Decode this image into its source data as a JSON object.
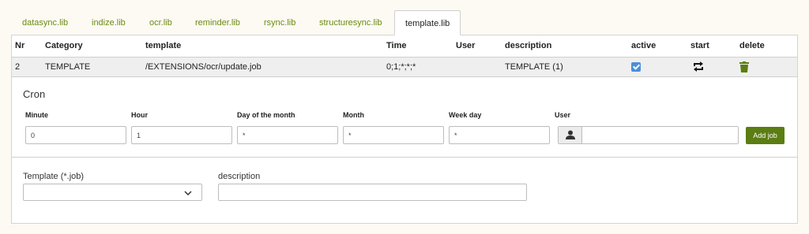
{
  "tabs": [
    {
      "label": "datasync.lib"
    },
    {
      "label": "indize.lib"
    },
    {
      "label": "ocr.lib"
    },
    {
      "label": "reminder.lib"
    },
    {
      "label": "rsync.lib"
    },
    {
      "label": "structuresync.lib"
    },
    {
      "label": "template.lib",
      "active": true
    }
  ],
  "table": {
    "headers": {
      "nr": "Nr",
      "category": "Category",
      "template": "template",
      "time": "Time",
      "user": "User",
      "description": "description",
      "active": "active",
      "start": "start",
      "delete": "delete"
    },
    "rows": [
      {
        "nr": "2",
        "category": "TEMPLATE",
        "template": "/EXTENSIONS/ocr/update.job",
        "time": "0;1;*;*;*",
        "user": "",
        "description": "TEMPLATE (1)",
        "active": true
      }
    ]
  },
  "cron": {
    "title": "Cron",
    "labels": {
      "minute": "Minute",
      "hour": "Hour",
      "day_of_month": "Day of the month",
      "month": "Month",
      "week_day": "Week day",
      "user": "User"
    },
    "values": {
      "minute": "0",
      "hour": "1",
      "day_of_month": "*",
      "month": "*",
      "week_day": "*",
      "user": ""
    },
    "add_button": "Add job"
  },
  "template_form": {
    "template_label": "Template (*.job)",
    "template_value": "",
    "description_label": "description",
    "description_value": ""
  },
  "colors": {
    "accent": "#5b7d12",
    "tab_link": "#6b8a12",
    "checkbox": "#4a90d9",
    "page_bg": "#fdfaf3"
  },
  "icons": {
    "start": "repeat-icon",
    "delete": "trash-icon",
    "user": "user-icon",
    "select": "chevron-down-icon"
  }
}
